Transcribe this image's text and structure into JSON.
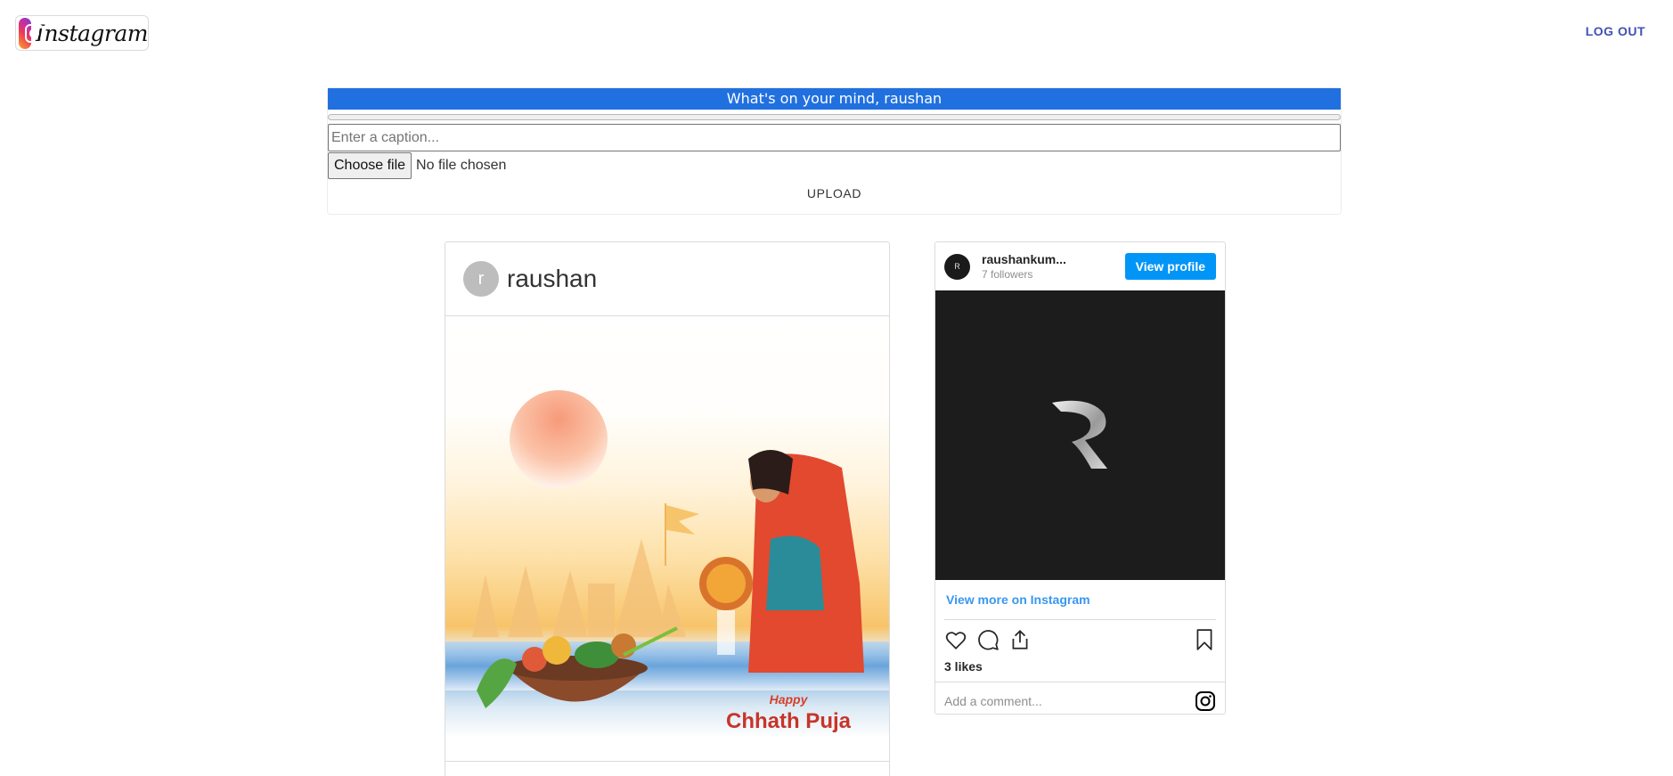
{
  "header": {
    "logo_text": "Instagram",
    "logout_label": "LOG OUT"
  },
  "upload": {
    "title": "What's on your mind, raushan",
    "caption_placeholder": "Enter a caption...",
    "file_button_label": "Choose file",
    "file_status": "No file chosen",
    "upload_label": "UPLOAD",
    "progress_value": 0
  },
  "post": {
    "avatar_letter": "r",
    "username": "raushan",
    "image": {
      "greeting_small": "Happy",
      "greeting_large": "Chhath Puja"
    }
  },
  "embed": {
    "avatar_letter": "R",
    "username": "raushankum...",
    "followers": "7 followers",
    "view_profile_label": "View profile",
    "view_more_label": "View more on Instagram",
    "likes": "3 likes",
    "comment_placeholder": "Add a comment..."
  },
  "colors": {
    "upload_title_bg": "#2170e0",
    "logout_text": "#3f51b5",
    "view_profile_bg": "#0095f6",
    "view_more_text": "#3897f0"
  }
}
